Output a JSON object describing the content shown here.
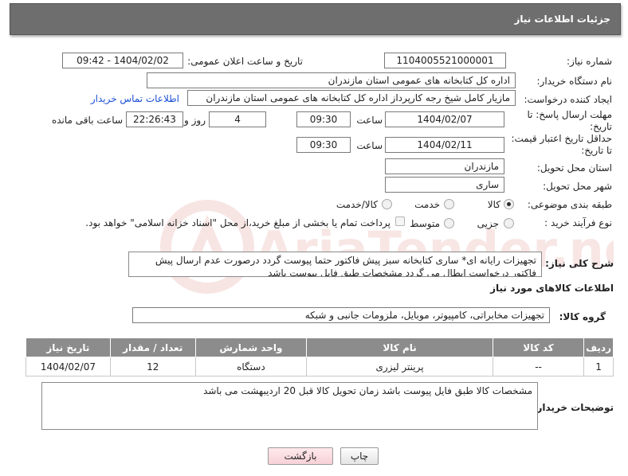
{
  "header": {
    "title": "جزئیات اطلاعات نیاز"
  },
  "labels": {
    "need_number": "شماره نیاز:",
    "announce_datetime": "تاریخ و ساعت اعلان عمومی:",
    "buyer_org": "نام دستگاه خریدار:",
    "requester": "ایجاد کننده درخواست:",
    "reply_deadline": "مهلت ارسال پاسخ: تا تاریخ:",
    "hour": "ساعت",
    "day_and": "روز و",
    "remaining": "ساعت باقی مانده",
    "price_validity": "حداقل تاریخ اعتبار قیمت: تا تاریخ:",
    "province": "استان محل تحویل:",
    "city": "شهر محل تحویل:",
    "category": "طبقه بندی موضوعی:",
    "purchase_type": "نوع فرآیند خرید :",
    "overall_desc": "شرح کلی نیاز:",
    "goods_info": "اطلاعات کالاهای مورد نیاز",
    "goods_group": "گروه کالا:",
    "buyer_notes": "توضیحات خریدار:"
  },
  "values": {
    "need_number": "1104005521000001",
    "announce_datetime": "1404/02/02 - 09:42",
    "buyer_org": "اداره کل کتابخانه های عمومی استان مازندران",
    "requester": "مازیار کامل شیخ رجه کارپرداز اداره کل کتابخانه های عمومی استان مازندران",
    "contact_link": "اطلاعات تماس خریدار",
    "reply_date": "1404/02/07",
    "reply_hour": "09:30",
    "reply_days": "4",
    "reply_remaining": "22:26:43",
    "price_date": "1404/02/11",
    "price_hour": "09:30",
    "province": "مازندران",
    "city": "ساری",
    "overall_desc": "تجهیزات رایانه ای* ساری کتابخانه سبز پیش فاکتور حتما پیوست گردد درصورت عدم ارسال پیش فاکتور درخواست ابطال می گردد مشخصات طبق فایل پیوست باشد",
    "goods_group": "تجهیزات مخابراتی، کامپیوتر، موبایل، ملزومات جانبی و شبکه",
    "buyer_notes": "مشخصات کالا طبق فایل پیوست باشد زمان تحویل کالا قبل 20 اردیبهشت می باشد"
  },
  "category_options": [
    {
      "label": "کالا",
      "selected": true
    },
    {
      "label": "خدمت",
      "selected": false
    },
    {
      "label": "کالا/خدمت",
      "selected": false
    }
  ],
  "purchase_options": [
    {
      "label": "جزیی",
      "selected": false
    },
    {
      "label": "متوسط",
      "selected": false
    }
  ],
  "payment_note": "پرداخت تمام یا بخشی از مبلغ خرید،از محل \"اسناد خزانه اسلامی\" خواهد بود.",
  "table": {
    "headers": [
      "ردیف",
      "کد کالا",
      "نام کالا",
      "واحد شمارش",
      "تعداد / مقدار",
      "تاریخ نیاز"
    ],
    "rows": [
      [
        "1",
        "--",
        "پرینتر لیزری",
        "دستگاه",
        "12",
        "1404/02/07"
      ]
    ]
  },
  "buttons": {
    "print": "چاپ",
    "back": "بازگشت"
  },
  "watermark": {
    "text": "AriaTender.neT"
  }
}
